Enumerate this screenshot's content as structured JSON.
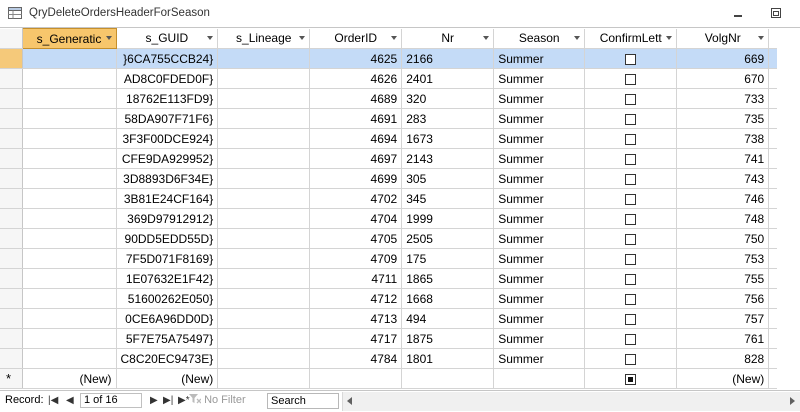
{
  "window": {
    "title": "QryDeleteOrdersHeaderForSeason"
  },
  "columns": [
    {
      "label": "s_Generatic",
      "selected": true
    },
    {
      "label": "s_GUID"
    },
    {
      "label": "s_Lineage"
    },
    {
      "label": "OrderID"
    },
    {
      "label": "Nr"
    },
    {
      "label": "Season"
    },
    {
      "label": "ConfirmLett"
    },
    {
      "label": "VolgNr"
    }
  ],
  "rows": [
    {
      "guid": "}6CA755CCB24}",
      "order_id": "4625",
      "nr": "2166",
      "season": "Summer",
      "confirm": false,
      "volg": "669",
      "current": true
    },
    {
      "guid": "AD8C0FDED0F}",
      "order_id": "4626",
      "nr": "2401",
      "season": "Summer",
      "confirm": false,
      "volg": "670"
    },
    {
      "guid": "18762E113FD9}",
      "order_id": "4689",
      "nr": "320",
      "season": "Summer",
      "confirm": false,
      "volg": "733"
    },
    {
      "guid": "58DA907F71F6}",
      "order_id": "4691",
      "nr": "283",
      "season": "Summer",
      "confirm": false,
      "volg": "735"
    },
    {
      "guid": "3F3F00DCE924}",
      "order_id": "4694",
      "nr": "1673",
      "season": "Summer",
      "confirm": false,
      "volg": "738"
    },
    {
      "guid": "CFE9DA929952}",
      "order_id": "4697",
      "nr": "2143",
      "season": "Summer",
      "confirm": false,
      "volg": "741"
    },
    {
      "guid": "3D8893D6F34E}",
      "order_id": "4699",
      "nr": "305",
      "season": "Summer",
      "confirm": false,
      "volg": "743"
    },
    {
      "guid": "3B81E24CF164}",
      "order_id": "4702",
      "nr": "345",
      "season": "Summer",
      "confirm": false,
      "volg": "746"
    },
    {
      "guid": "369D97912912}",
      "order_id": "4704",
      "nr": "1999",
      "season": "Summer",
      "confirm": false,
      "volg": "748"
    },
    {
      "guid": "90DD5EDD55D}",
      "order_id": "4705",
      "nr": "2505",
      "season": "Summer",
      "confirm": false,
      "volg": "750"
    },
    {
      "guid": "7F5D071F8169}",
      "order_id": "4709",
      "nr": "175",
      "season": "Summer",
      "confirm": false,
      "volg": "753"
    },
    {
      "guid": "1E07632E1F42}",
      "order_id": "4711",
      "nr": "1865",
      "season": "Summer",
      "confirm": false,
      "volg": "755"
    },
    {
      "guid": "51600262E050}",
      "order_id": "4712",
      "nr": "1668",
      "season": "Summer",
      "confirm": false,
      "volg": "756"
    },
    {
      "guid": "0CE6A96DD0D}",
      "order_id": "4713",
      "nr": "494",
      "season": "Summer",
      "confirm": false,
      "volg": "757"
    },
    {
      "guid": "5F7E75A75497}",
      "order_id": "4717",
      "nr": "1875",
      "season": "Summer",
      "confirm": false,
      "volg": "761"
    },
    {
      "guid": "C8C20EC9473E}",
      "order_id": "4784",
      "nr": "1801",
      "season": "Summer",
      "confirm": false,
      "volg": "828"
    }
  ],
  "new_row": {
    "marker": "*",
    "generation": "(New)",
    "guid": "(New)",
    "volg": "(New)"
  },
  "status": {
    "record_label": "Record:",
    "first_icon": "first-record-icon",
    "prev_icon": "previous-record-icon",
    "position": "1 of 16",
    "next_icon": "next-record-icon",
    "last_icon": "last-record-icon",
    "new_icon": "new-record-icon",
    "filter_icon": "no-filter-icon",
    "filter_label": "No Filter",
    "search_label": "Search"
  },
  "colors": {
    "selected_column_header": "#f7c66c",
    "current_row": "#c4dbf7",
    "grid_line": "#d4d4d4"
  }
}
